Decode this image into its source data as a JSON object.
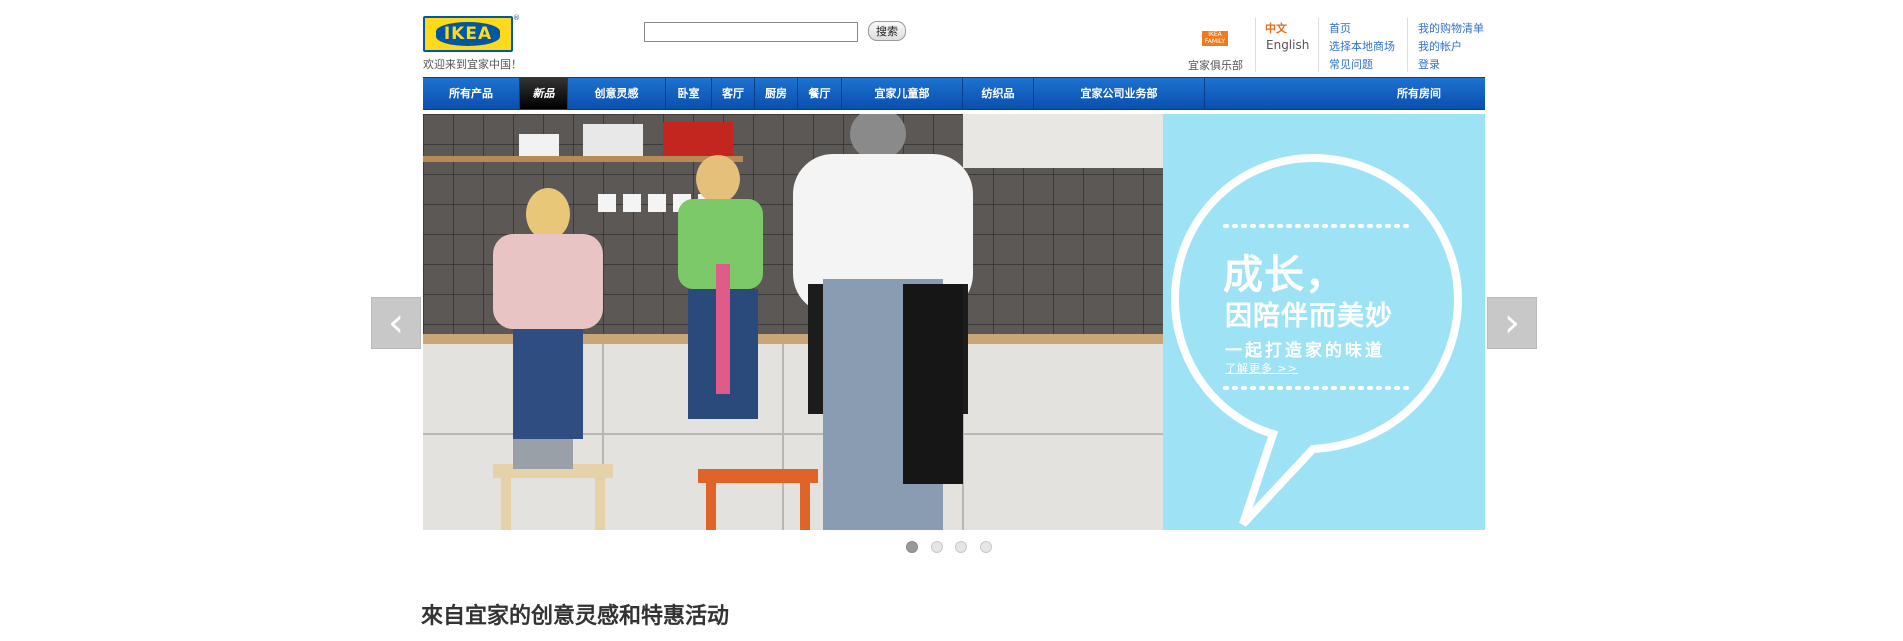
{
  "header": {
    "logo_text": "IKEA",
    "logo_reg": "®",
    "welcome": "欢迎来到宜家中国！",
    "search": {
      "value": "",
      "button": "搜索"
    },
    "club": {
      "icon_text": "IKEA FAMILY",
      "label": "宜家俱乐部"
    },
    "languages": {
      "chinese": "中文",
      "english": "English"
    },
    "links_col1": [
      "首页",
      "选择本地商场",
      "常见问题"
    ],
    "links_col2": [
      "我的购物清单",
      "我的帐户",
      "登录"
    ]
  },
  "nav": {
    "items": [
      "所有产品",
      "新品",
      "创意灵感",
      "卧室",
      "客厅",
      "厨房",
      "餐厅",
      "宜家儿童部",
      "纺织品",
      "宜家公司业务部",
      "所有房间"
    ],
    "active_index": 1
  },
  "banner": {
    "headline": "成长，",
    "subhead": "因陪伴而美妙",
    "tagline": "一起打造家的味道",
    "link": "了解更多 >>",
    "prev_label": "‹",
    "next_label": "›",
    "slide_count": 4,
    "active_slide": 1
  },
  "section": {
    "title": "來自宜家的创意灵感和特惠活动"
  },
  "colors": {
    "nav_blue": "#0a4fae",
    "promo_blue": "#9ee3f5",
    "accent_orange": "#e66a1e",
    "link_blue": "#3173c5"
  }
}
